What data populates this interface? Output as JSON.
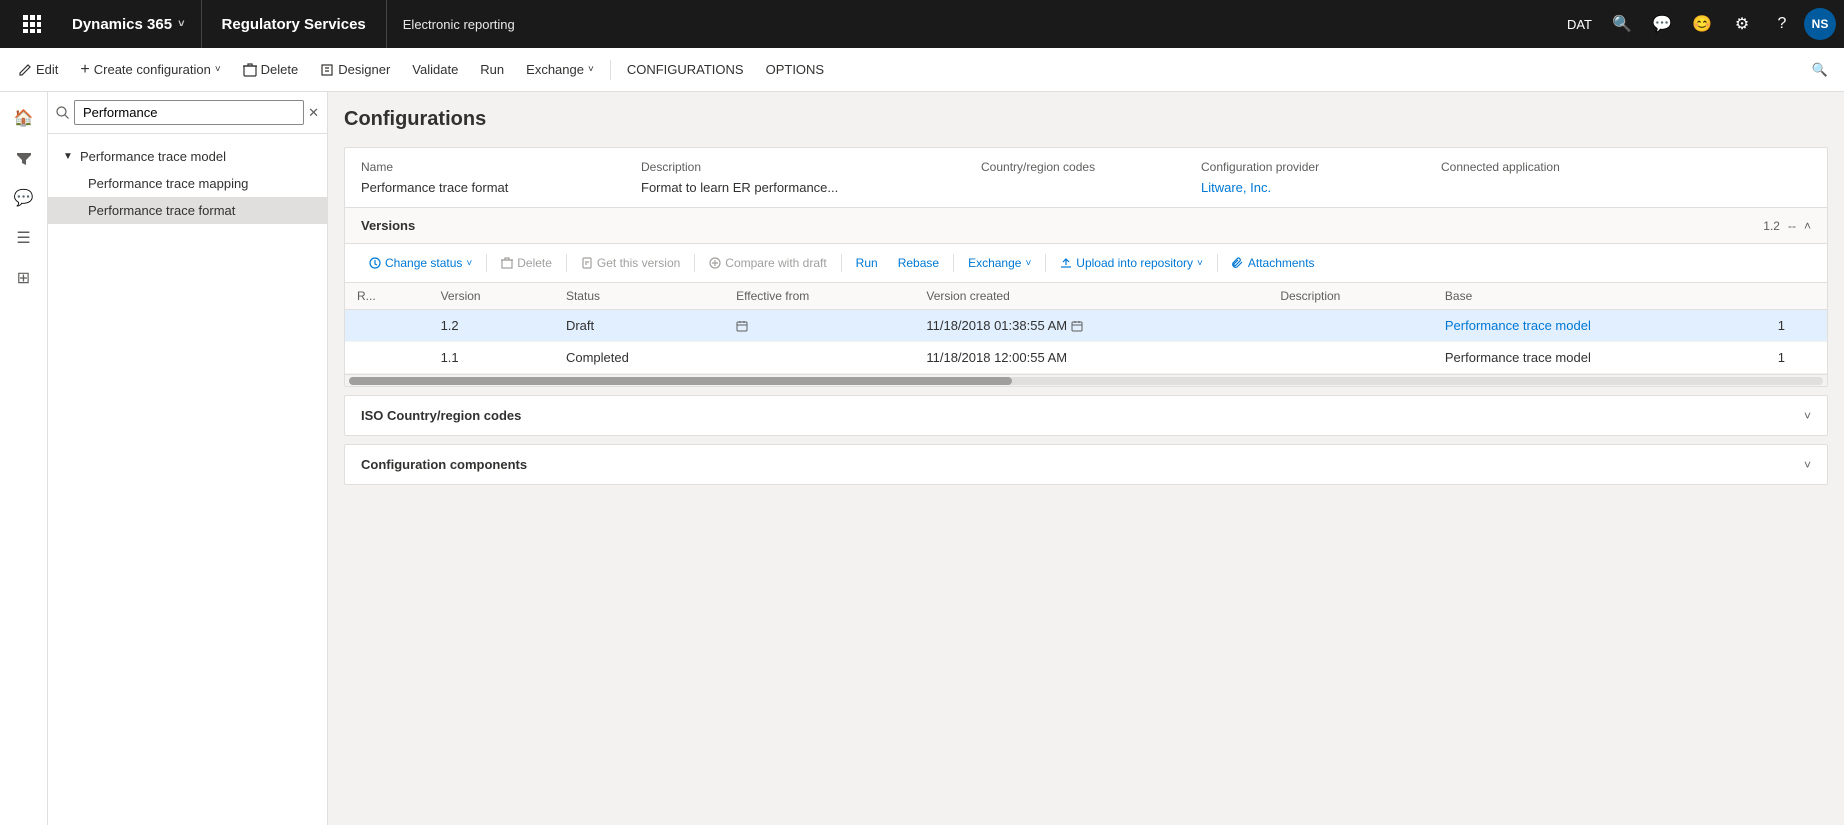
{
  "topnav": {
    "apps_label": "⊞",
    "d365_label": "Dynamics 365",
    "module_label": "Regulatory Services",
    "page_label": "Electronic reporting",
    "dat_label": "DAT",
    "avatar_label": "NS"
  },
  "commandbar": {
    "edit_label": "Edit",
    "create_config_label": "Create configuration",
    "delete_label": "Delete",
    "designer_label": "Designer",
    "validate_label": "Validate",
    "run_label": "Run",
    "exchange_label": "Exchange",
    "configurations_label": "CONFIGURATIONS",
    "options_label": "OPTIONS"
  },
  "tree": {
    "search_placeholder": "Performance",
    "search_value": "Performance",
    "root_item": "Performance trace model",
    "child_items": [
      {
        "label": "Performance trace mapping",
        "selected": false
      },
      {
        "label": "Performance trace format",
        "selected": true
      }
    ]
  },
  "page": {
    "title": "Configurations"
  },
  "config_detail": {
    "name_label": "Name",
    "name_value": "Performance trace format",
    "description_label": "Description",
    "description_value": "Format to learn ER performance...",
    "country_label": "Country/region codes",
    "country_value": "",
    "provider_label": "Configuration provider",
    "provider_value": "Litware, Inc.",
    "connected_label": "Connected application",
    "connected_value": ""
  },
  "versions": {
    "section_title": "Versions",
    "version_display": "1.2",
    "version_sep": "--",
    "toolbar": {
      "change_status_label": "Change status",
      "delete_label": "Delete",
      "get_version_label": "Get this version",
      "compare_label": "Compare with draft",
      "run_label": "Run",
      "rebase_label": "Rebase",
      "exchange_label": "Exchange",
      "upload_label": "Upload into repository",
      "attachments_label": "Attachments"
    },
    "columns": [
      "R...",
      "Version",
      "Status",
      "Effective from",
      "Version created",
      "Description",
      "Base",
      ""
    ],
    "rows": [
      {
        "r": "",
        "version": "1.2",
        "status": "Draft",
        "effective_from": "",
        "version_created": "11/18/2018 01:38:55 AM",
        "description": "",
        "base": "Performance trace model",
        "base_num": "1",
        "active": true
      },
      {
        "r": "",
        "version": "1.1",
        "status": "Completed",
        "effective_from": "",
        "version_created": "11/18/2018 12:00:55 AM",
        "description": "",
        "base": "Performance trace model",
        "base_num": "1",
        "active": false
      }
    ]
  },
  "sections": {
    "iso_title": "ISO Country/region codes",
    "components_title": "Configuration components"
  }
}
